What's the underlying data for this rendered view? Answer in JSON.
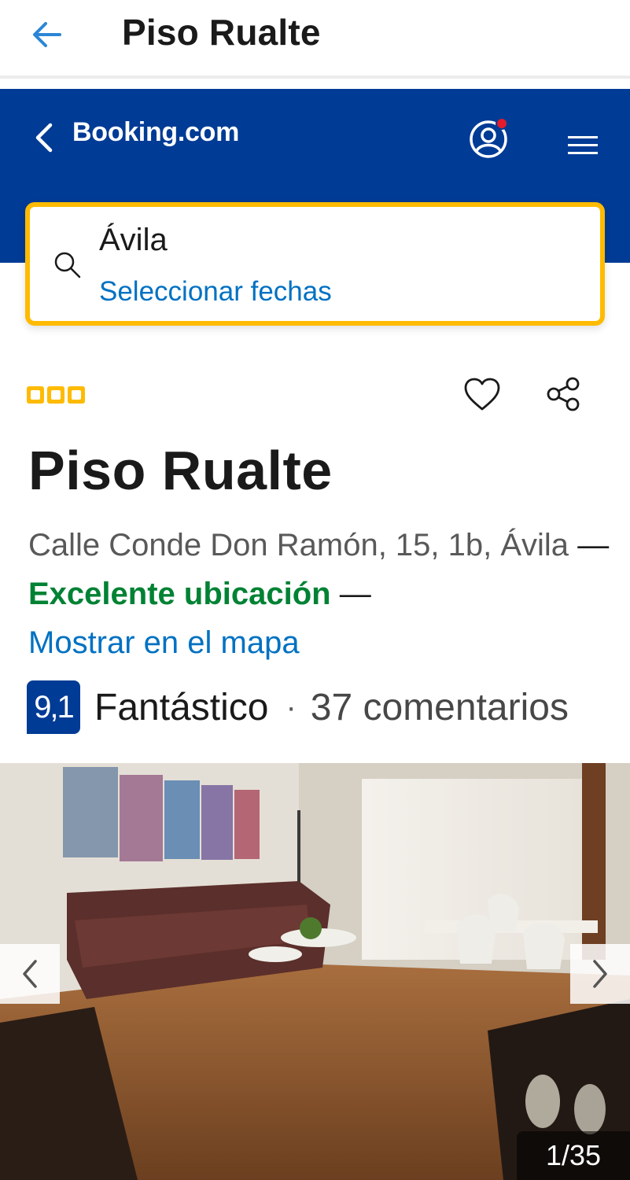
{
  "appbar": {
    "title": "Piso Rualte",
    "back_icon": "arrow-left-icon"
  },
  "booking_header": {
    "brand": "Booking.com",
    "back_icon": "chevron-left-icon",
    "account_icon": "user-circle-icon",
    "menu_icon": "hamburger-icon"
  },
  "search": {
    "icon": "search-icon",
    "city": "Ávila",
    "dates": "Seleccionar fechas"
  },
  "property": {
    "stars": 3,
    "name": "Piso Rualte",
    "address_line": "Calle Conde Don Ramón, 15, 1b, Ávila",
    "dash": "—",
    "location_label": "Excelente ubicación",
    "map_link": "Mostrar en el mapa",
    "score": "9,1",
    "score_label": "Fantástico",
    "separator": "·",
    "reviews": "37 comentarios"
  },
  "gallery": {
    "counter": "1/35",
    "prev_icon": "chevron-left-icon",
    "next_icon": "chevron-right-icon"
  },
  "colors": {
    "brand_blue": "#003b95",
    "accent_yellow": "#febb02",
    "link_blue": "#0071c2",
    "green": "#008234"
  }
}
